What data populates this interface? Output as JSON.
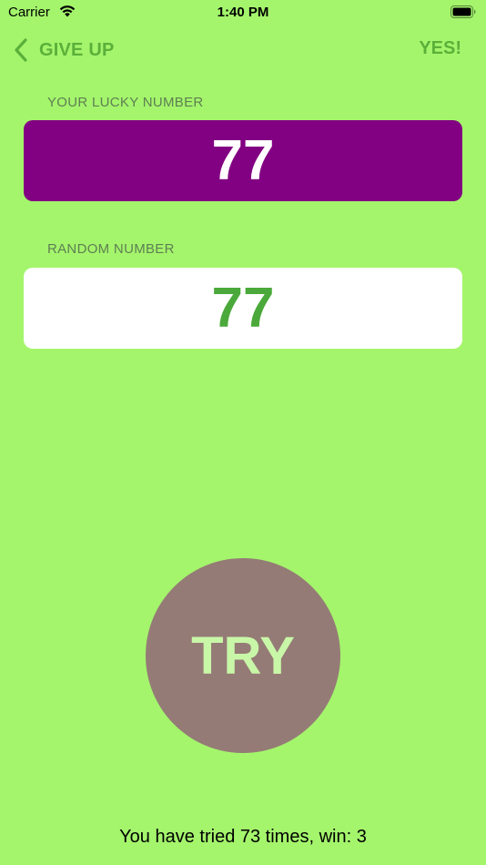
{
  "status_bar": {
    "carrier": "Carrier",
    "time": "1:40 PM",
    "wifi_icon": "wifi-icon",
    "battery_icon": "battery-icon"
  },
  "nav": {
    "back_label": "GIVE UP",
    "back_icon": "chevron-left-icon",
    "action_label": "YES!",
    "accent_color": "#5bb03a"
  },
  "lucky": {
    "label": "YOUR LUCKY NUMBER",
    "value": "77",
    "background_color": "#820082"
  },
  "random": {
    "label": "RANDOM NUMBER",
    "value": "77",
    "text_color": "#4aa93a"
  },
  "try_button": {
    "label": "TRY",
    "background_color": "#957b76"
  },
  "stats": {
    "text": "You have tried 73 times, win: 3"
  },
  "colors": {
    "background": "#a4f56c"
  }
}
